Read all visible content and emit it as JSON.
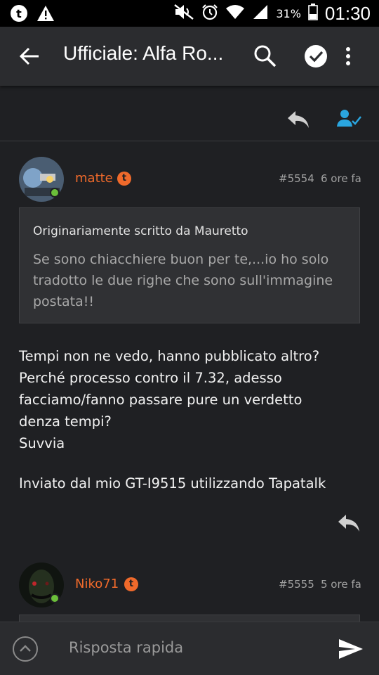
{
  "status_bar": {
    "battery": "31%",
    "time": "01:30"
  },
  "app_bar": {
    "title": "Ufficiale: Alfa Ro..."
  },
  "posts": [
    {
      "username": "matte",
      "post_number": "#5554",
      "time_ago": "6 ore fa",
      "quote": {
        "author_line": "Originariamente scritto da Mauretto",
        "text": "Se sono chiacchiere buon per te,...io ho solo tradotto le due righe che sono sull'immagine postata!!"
      },
      "body_lines": [
        "Tempi non ne vedo, hanno pubblicato altro?",
        "Perché processo contro il 7.32, adesso",
        "facciamo/fanno passare pure un verdetto",
        "denza tempi?",
        "Suvvia"
      ],
      "signature": "Inviato dal mio GT-I9515 utilizzando Tapatalk"
    },
    {
      "username": "Niko71",
      "post_number": "#5555",
      "time_ago": "5 ore fa"
    }
  ],
  "bottom_bar": {
    "placeholder": "Risposta rapida"
  },
  "colors": {
    "accent_orange": "#f06a2b",
    "accent_blue": "#2aa6e0",
    "online_green": "#6bbf3a"
  }
}
